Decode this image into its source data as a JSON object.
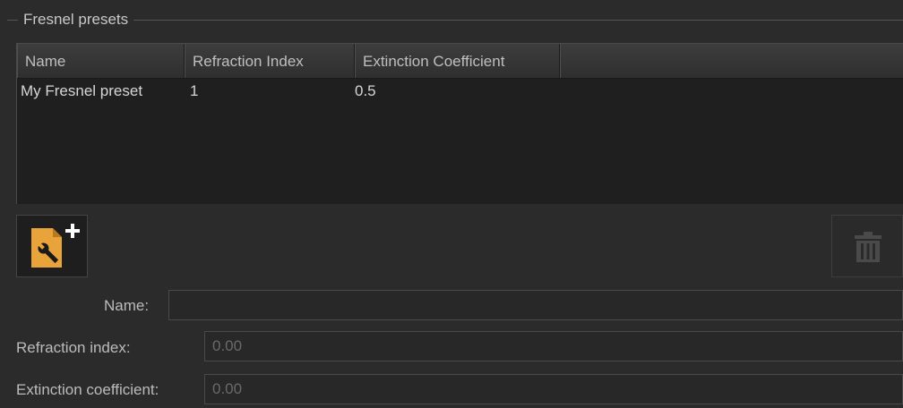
{
  "group": {
    "title": "Fresnel presets"
  },
  "table": {
    "columns": [
      "Name",
      "Refraction Index",
      "Extinction Coefficient",
      ""
    ],
    "rows": [
      [
        "My Fresnel preset",
        "1",
        "0.5"
      ]
    ]
  },
  "buttons": {
    "add_icon": "new-preset-icon",
    "delete_icon": "trash-icon",
    "accent_color": "#e8a33a"
  },
  "form": {
    "name_label": "Name:",
    "name_value": "",
    "refraction_label": "Refraction index:",
    "refraction_value": "0.00",
    "extinction_label": "Extinction coefficient:",
    "extinction_value": "0.00"
  }
}
